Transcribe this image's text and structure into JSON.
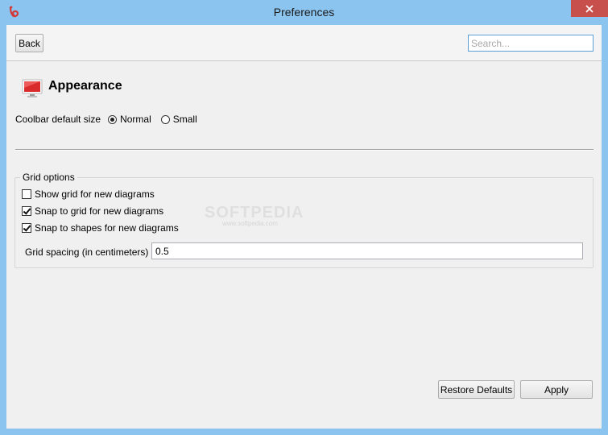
{
  "window": {
    "title": "Preferences",
    "close_icon": "close-icon",
    "app_icon": "app-logo-icon"
  },
  "toolbar": {
    "back_label": "Back",
    "search_placeholder": "Search..."
  },
  "page": {
    "title": "Appearance",
    "icon": "monitor-icon"
  },
  "coolbar": {
    "label": "Coolbar default size",
    "options": [
      {
        "label": "Normal",
        "selected": true
      },
      {
        "label": "Small",
        "selected": false
      }
    ]
  },
  "grid_options": {
    "title": "Grid options",
    "checkboxes": [
      {
        "label": "Show grid for new diagrams",
        "checked": false
      },
      {
        "label": "Snap to grid for new diagrams",
        "checked": true
      },
      {
        "label": "Snap to shapes for new diagrams",
        "checked": true
      }
    ],
    "spacing_label": "Grid spacing (in centimeters)",
    "spacing_value": "0.5"
  },
  "watermark": {
    "text": "SOFTPEDIA",
    "sub": "www.softpedia.com"
  },
  "footer": {
    "restore_label": "Restore Defaults",
    "apply_label": "Apply"
  },
  "colors": {
    "title_bar": "#8cc4f0",
    "close_button": "#c7504d",
    "accent_focus": "#5c9ed6"
  }
}
